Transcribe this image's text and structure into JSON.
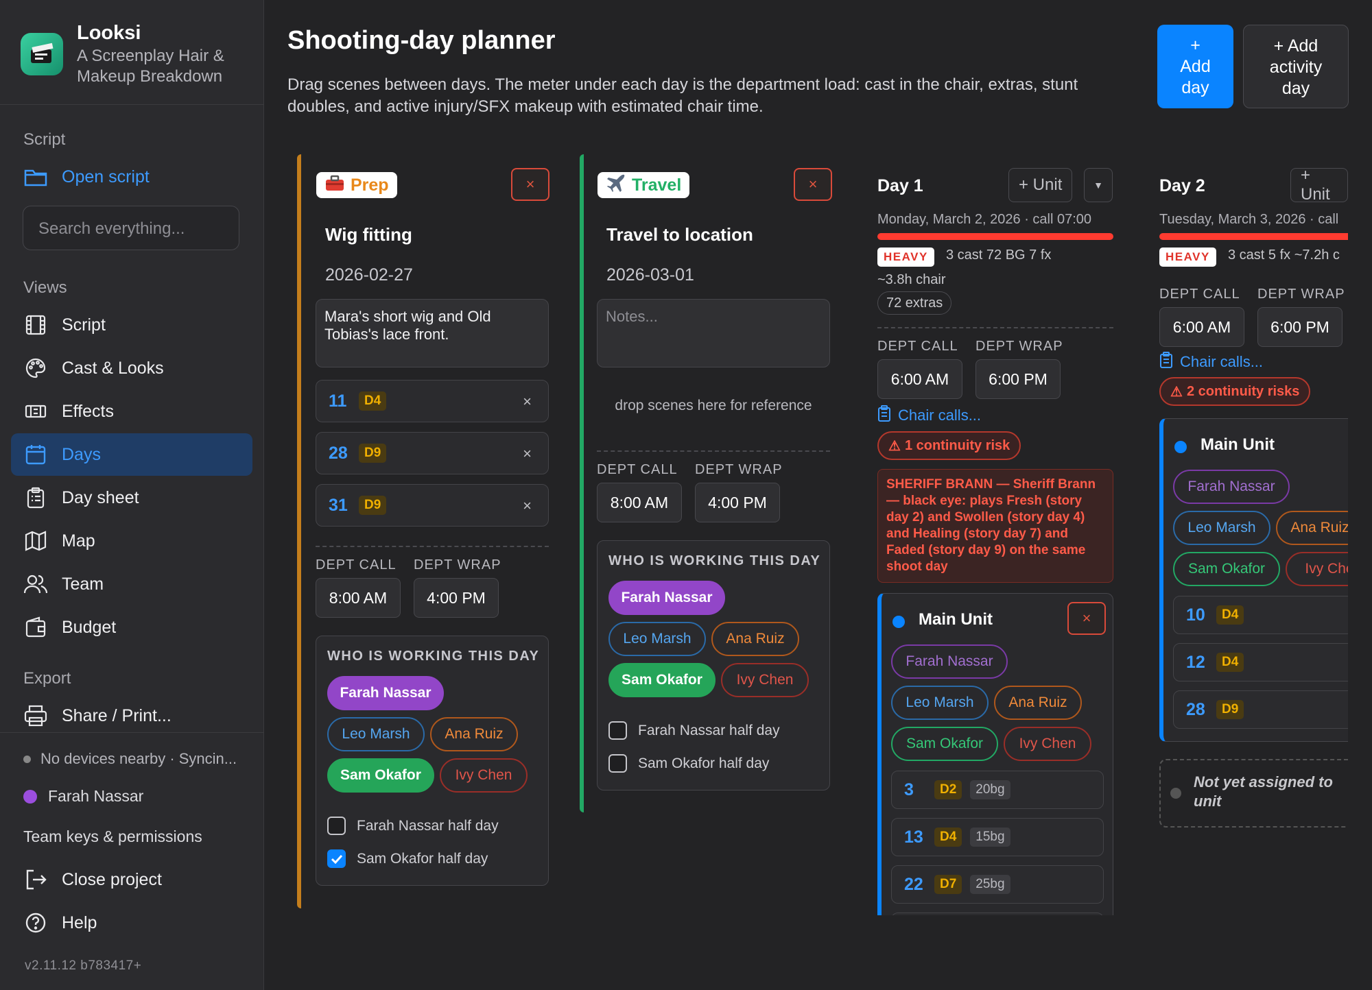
{
  "app": {
    "name": "Looksi",
    "subtitle_line1": "A Screenplay Hair &",
    "subtitle_line2": "Makeup Breakdown",
    "version": "v2.11.12 b783417+"
  },
  "sidebar": {
    "script_section": "Script",
    "open_script": "Open script",
    "search_placeholder": "Search everything...",
    "views_section": "Views",
    "items": [
      "Script",
      "Cast & Looks",
      "Effects",
      "Days",
      "Day sheet",
      "Map",
      "Team",
      "Budget"
    ],
    "export_section": "Export",
    "share": "Share / Print...",
    "sync_status": "No devices nearby · Syncin...",
    "user": "Farah Nassar",
    "team_keys": "Team keys & permissions",
    "close_project": "Close project",
    "help": "Help"
  },
  "header": {
    "title": "Shooting-day planner",
    "description": "Drag scenes between days. The meter under each day is the department load: cast in the chair, extras, stunt doubles, and active injury/SFX makeup with estimated chair time.",
    "add_day": [
      "+",
      "Add",
      "day"
    ],
    "add_activity_day": [
      "+ Add",
      "activity",
      "day"
    ]
  },
  "common": {
    "dept_call": "DEPT CALL",
    "dept_wrap": "DEPT WRAP",
    "who_working": "WHO IS WORKING THIS DAY",
    "close_x": "×"
  },
  "prep": {
    "tag": "Prep",
    "title": "Wig fitting",
    "date": "2026-02-27",
    "notes": "Mara's short wig and Old Tobias's lace front.",
    "scenes": [
      {
        "num": "11",
        "day": "D4"
      },
      {
        "num": "28",
        "day": "D9"
      },
      {
        "num": "31",
        "day": "D9"
      }
    ],
    "call": "8:00 AM",
    "wrap": "4:00 PM",
    "team": [
      "Farah Nassar",
      "Leo Marsh",
      "Ana Ruiz",
      "Sam Okafor",
      "Ivy Chen"
    ],
    "half": [
      {
        "label": "Farah Nassar half day",
        "checked": false
      },
      {
        "label": "Sam Okafor half day",
        "checked": true
      }
    ]
  },
  "travel": {
    "tag": "Travel",
    "title": "Travel to location",
    "date": "2026-03-01",
    "notes_placeholder": "Notes...",
    "drop_hint": "drop scenes here for reference",
    "call": "8:00 AM",
    "wrap": "4:00 PM",
    "team": [
      "Farah Nassar",
      "Leo Marsh",
      "Ana Ruiz",
      "Sam Okafor",
      "Ivy Chen"
    ],
    "half": [
      {
        "label": "Farah Nassar half day",
        "checked": false
      },
      {
        "label": "Sam Okafor half day",
        "checked": false
      }
    ]
  },
  "day1": {
    "title": "Day 1",
    "unit_btn": "+ Unit",
    "date": "Monday, March 2, 2026 · call 07:00",
    "load": "HEAVY",
    "stats": "3 cast  72 BG  7 fx",
    "chair": "~3.8h chair",
    "extras": "72 extras",
    "call": "6:00 AM",
    "wrap": "6:00 PM",
    "chair_calls": "Chair calls...",
    "risk": "1 continuity risk",
    "risk_detail": "SHERIFF BRANN — Sheriff Brann — black eye: plays Fresh (story day 2) and Swollen (story day 4) and Healing (story day 7) and Faded (story day 9) on the same shoot day",
    "unit": {
      "name": "Main Unit",
      "team": [
        "Farah Nassar",
        "Leo Marsh",
        "Ana Ruiz",
        "Sam Okafor",
        "Ivy Chen"
      ],
      "scenes": [
        {
          "num": "3",
          "day": "D2",
          "bg": "20bg"
        },
        {
          "num": "13",
          "day": "D4",
          "bg": "15bg"
        },
        {
          "num": "22",
          "day": "D7",
          "bg": "25bg"
        }
      ]
    }
  },
  "day2": {
    "title": "Day 2",
    "unit_btn": "+ Unit",
    "date": "Tuesday, March 3, 2026 · call",
    "load": "HEAVY",
    "stats": "3 cast  5 fx  ~7.2h c",
    "call": "6:00 AM",
    "wrap": "6:00 PM",
    "chair_calls": "Chair calls...",
    "risk": "2 continuity risks",
    "unit": {
      "name": "Main Unit",
      "team": [
        "Farah Nassar",
        "Leo Marsh",
        "Ana Ruiz",
        "Sam Okafor",
        "Ivy Che"
      ],
      "scenes": [
        {
          "num": "10",
          "day": "D4"
        },
        {
          "num": "12",
          "day": "D4"
        },
        {
          "num": "28",
          "day": "D9"
        }
      ]
    },
    "unassigned": "Not yet assigned to unit"
  },
  "colors": {
    "accent": "#0a84ff",
    "prep": "#d98a1a",
    "travel": "#2fbf71",
    "danger": "#ff3b30"
  }
}
